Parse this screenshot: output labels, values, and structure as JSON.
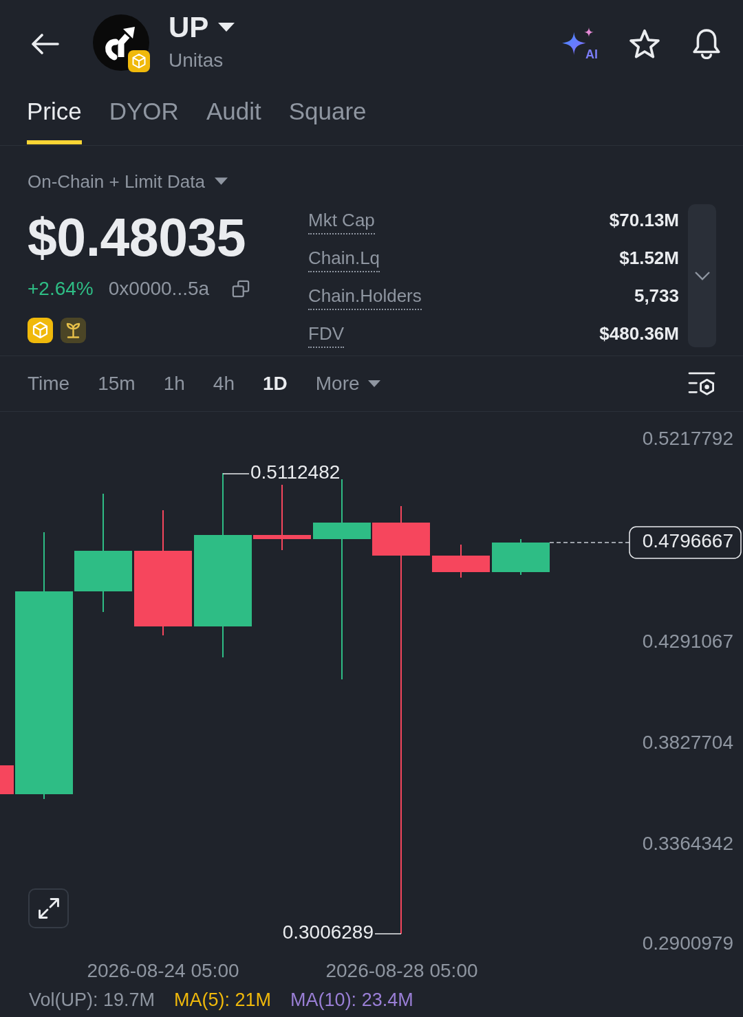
{
  "header": {
    "title": "UP",
    "subtitle": "Unitas",
    "ai_label": "AI"
  },
  "tabs": [
    {
      "label": "Price",
      "selected": true
    },
    {
      "label": "DYOR",
      "selected": false
    },
    {
      "label": "Audit",
      "selected": false
    },
    {
      "label": "Square",
      "selected": false
    }
  ],
  "overview": {
    "data_source": "On-Chain + Limit Data",
    "price": "$0.48035",
    "change": "+2.64%",
    "positive": true,
    "address": "0x0000...5a",
    "stats": [
      {
        "label": "Mkt Cap",
        "value": "$70.13M"
      },
      {
        "label": "Chain.Lq",
        "value": "$1.52M"
      },
      {
        "label": "Chain.Holders",
        "value": "5,733"
      },
      {
        "label": "FDV",
        "value": "$480.36M"
      }
    ],
    "stats_expanded": false
  },
  "intervals": [
    {
      "label": "Time",
      "kind": "option",
      "selected": false
    },
    {
      "label": "15m",
      "kind": "option",
      "selected": false
    },
    {
      "label": "1h",
      "kind": "option",
      "selected": false
    },
    {
      "label": "4h",
      "kind": "option",
      "selected": false
    },
    {
      "label": "1D",
      "kind": "option",
      "selected": true
    },
    {
      "label": "More",
      "kind": "menu",
      "selected": false
    }
  ],
  "chart": {
    "price_axis": [
      "0.5217792",
      "0.4291067",
      "0.3827704",
      "0.3364342",
      "0.2900979"
    ],
    "time_axis": [
      "2026-08-24 05:00",
      "2026-08-28 05:00"
    ],
    "high_marker": "0.5112482",
    "low_marker": "0.3006289",
    "last_price": "0.4796667",
    "volume_legend": [
      {
        "label": "Vol(UP): 19.7M",
        "color": "#8f96a1"
      },
      {
        "label": "MA(5): 21M",
        "color": "#f0b90b"
      },
      {
        "label": "MA(10): 23.4M",
        "color": "#9a7fd6"
      }
    ]
  }
}
